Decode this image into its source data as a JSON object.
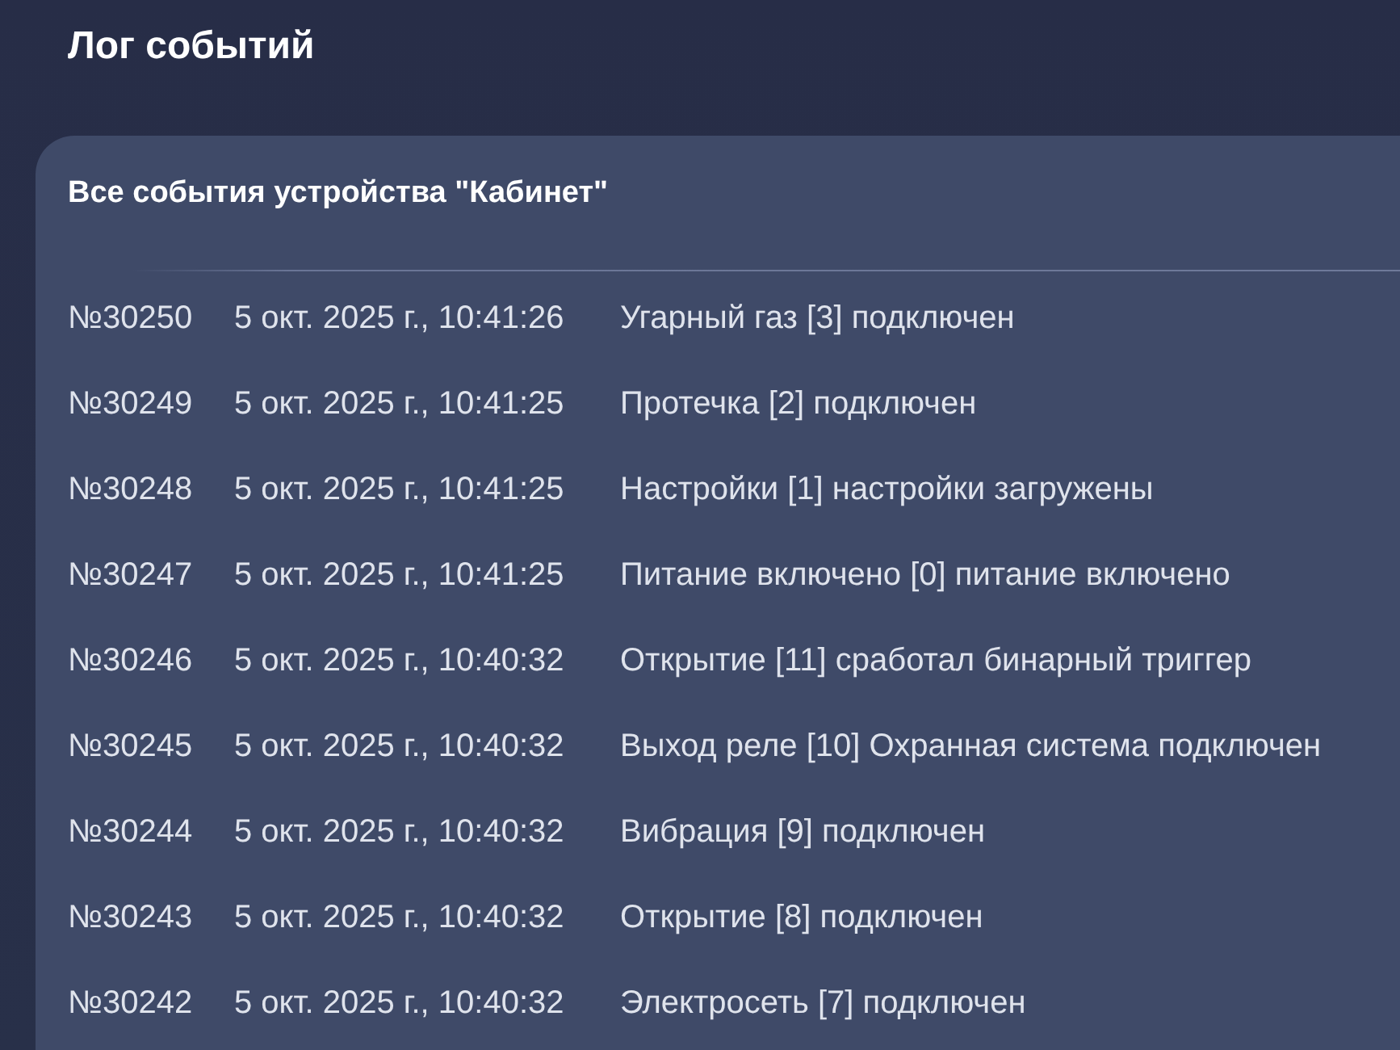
{
  "page": {
    "title": "Лог событий"
  },
  "card": {
    "title": "Все события устройства \"Кабинет\"",
    "events": [
      {
        "number": "№30250",
        "datetime": "5 окт. 2025 г., 10:41:26",
        "text": "Угарный газ [3] подключен"
      },
      {
        "number": "№30249",
        "datetime": "5 окт. 2025 г., 10:41:25",
        "text": "Протечка [2] подключен"
      },
      {
        "number": "№30248",
        "datetime": "5 окт. 2025 г., 10:41:25",
        "text": "Настройки [1] настройки загружены"
      },
      {
        "number": "№30247",
        "datetime": "5 окт. 2025 г., 10:41:25",
        "text": "Питание включено [0] питание включено"
      },
      {
        "number": "№30246",
        "datetime": "5 окт. 2025 г., 10:40:32",
        "text": "Открытие [11] сработал бинарный триггер"
      },
      {
        "number": "№30245",
        "datetime": "5 окт. 2025 г., 10:40:32",
        "text": "Выход реле [10] Охранная система подключен"
      },
      {
        "number": "№30244",
        "datetime": "5 окт. 2025 г., 10:40:32",
        "text": "Вибрация [9] подключен"
      },
      {
        "number": "№30243",
        "datetime": "5 окт. 2025 г., 10:40:32",
        "text": "Открытие [8] подключен"
      },
      {
        "number": "№30242",
        "datetime": "5 окт. 2025 г., 10:40:32",
        "text": "Электросеть [7] подключен"
      }
    ]
  }
}
